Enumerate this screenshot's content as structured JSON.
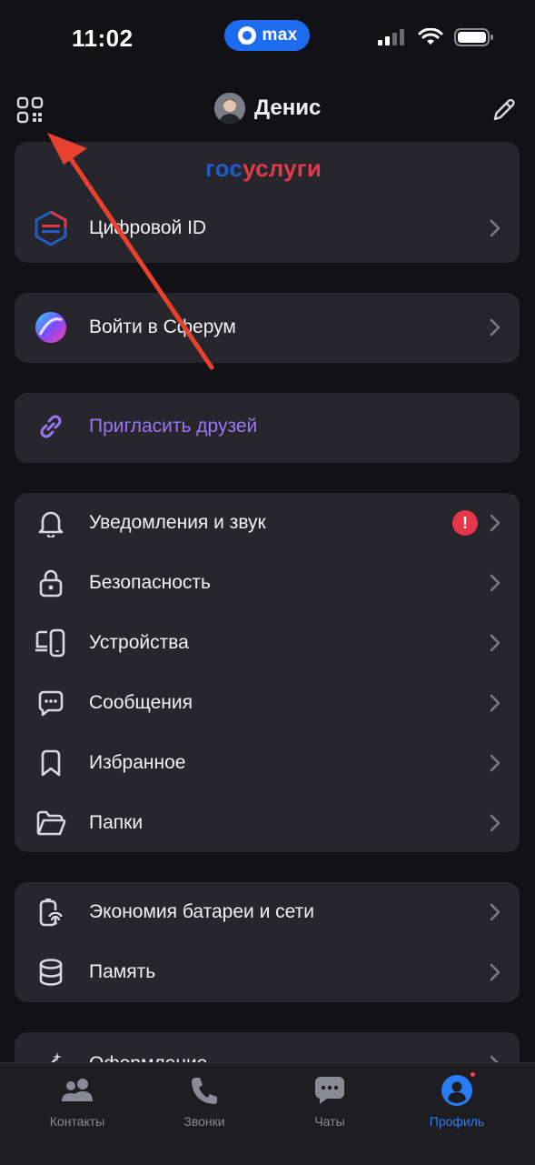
{
  "status_bar": {
    "time": "11:02",
    "app_name": "max",
    "icons": [
      "signal-icon",
      "wifi-icon",
      "battery-icon"
    ]
  },
  "header": {
    "name": "Денис",
    "left_icon": "qr-code-icon",
    "right_icon": "pencil-icon"
  },
  "gosuslugi": {
    "logo_part1": "гос",
    "logo_part2": "услуги",
    "digital_id_label": "Цифровой ID"
  },
  "sferum": {
    "label": "Войти в Сферум"
  },
  "invite": {
    "label": "Пригласить друзей"
  },
  "settings": {
    "items": [
      {
        "label": "Уведомления и звук",
        "icon": "bell-icon",
        "alert": "!"
      },
      {
        "label": "Безопасность",
        "icon": "lock-icon"
      },
      {
        "label": "Устройства",
        "icon": "devices-icon"
      },
      {
        "label": "Сообщения",
        "icon": "message-icon"
      },
      {
        "label": "Избранное",
        "icon": "bookmark-icon"
      },
      {
        "label": "Папки",
        "icon": "folder-icon"
      }
    ]
  },
  "storage": {
    "items": [
      {
        "label": "Экономия батареи и сети",
        "icon": "battery-saver-icon"
      },
      {
        "label": "Память",
        "icon": "database-icon"
      }
    ]
  },
  "appearance": {
    "label": "Оформление"
  },
  "tab_bar": {
    "tabs": [
      {
        "label": "Контакты",
        "icon": "contacts-icon"
      },
      {
        "label": "Звонки",
        "icon": "phone-icon"
      },
      {
        "label": "Чаты",
        "icon": "chat-icon"
      },
      {
        "label": "Профиль",
        "icon": "profile-icon",
        "active": true
      }
    ]
  },
  "colors": {
    "background": "#121216",
    "card": "#26262c",
    "accent_blue": "#2a7cf6",
    "invite_purple": "#9a78f5",
    "alert_red": "#e5364a",
    "annotation_arrow": "#e8412f"
  }
}
